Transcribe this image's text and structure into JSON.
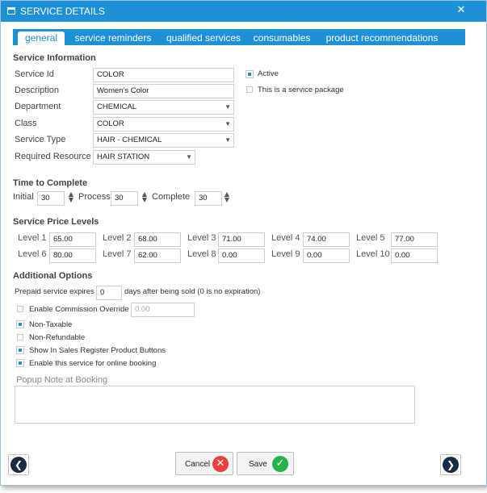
{
  "window": {
    "title": "SERVICE DETAILS",
    "close": "✕"
  },
  "tabs": [
    "general",
    "service reminders",
    "qualified services",
    "consumables",
    "product recommendations"
  ],
  "service_info": {
    "heading": "Service Information",
    "service_id_label": "Service Id",
    "service_id": "COLOR",
    "description_label": "Description",
    "description": "Women's Color",
    "department_label": "Department",
    "department": "CHEMICAL",
    "class_label": "Class",
    "class": "COLOR",
    "service_type_label": "Service Type",
    "service_type": "HAIR - CHEMICAL",
    "required_resource_label": "Required Resource",
    "required_resource": "HAIR STATION",
    "active_label": "Active",
    "active": true,
    "package_label": "This is a service package",
    "package": false
  },
  "time": {
    "heading": "Time to Complete",
    "initial_label": "Initial",
    "initial": "30",
    "process_label": "Process",
    "process": "30",
    "complete_label": "Complete",
    "complete": "30"
  },
  "price_levels": {
    "heading": "Service Price Levels",
    "levels": [
      {
        "label": "Level 1",
        "value": "65.00"
      },
      {
        "label": "Level 2",
        "value": "68.00"
      },
      {
        "label": "Level 3",
        "value": "71.00"
      },
      {
        "label": "Level 4",
        "value": "74.00"
      },
      {
        "label": "Level 5",
        "value": "77.00"
      },
      {
        "label": "Level 6",
        "value": "80.00"
      },
      {
        "label": "Level 7",
        "value": "62.00"
      },
      {
        "label": "Level 8",
        "value": "0.00"
      },
      {
        "label": "Level 9",
        "value": "0.00"
      },
      {
        "label": "Level 10",
        "value": "0.00"
      }
    ]
  },
  "options": {
    "heading": "Additional Options",
    "prepaid_prefix": "Prepaid service expires",
    "prepaid_days": "0",
    "prepaid_suffix": "days after being sold (0 is no expiration)",
    "commission_label": "Enable Commission Override",
    "commission_value": "0.00",
    "commission": false,
    "non_taxable_label": "Non-Taxable",
    "non_taxable": true,
    "non_refundable_label": "Non-Refundable",
    "non_refundable": false,
    "sales_register_label": "Show In Sales Register Product Buttons",
    "sales_register": true,
    "online_booking_label": "Enable this service for online booking",
    "online_booking": true,
    "popup_note_placeholder": "Popup Note at Booking"
  },
  "buttons": {
    "cancel": "Cancel",
    "save": "Save"
  },
  "icons": {
    "back": "chevron-left-icon",
    "forward": "chevron-right-icon",
    "cancel": "x-circle-icon",
    "save": "check-circle-icon"
  },
  "colors": {
    "accent": "#1e90d8",
    "cancel_red": "#e8403c",
    "save_green": "#27b34a",
    "nav_dark": "#1b2a44"
  }
}
